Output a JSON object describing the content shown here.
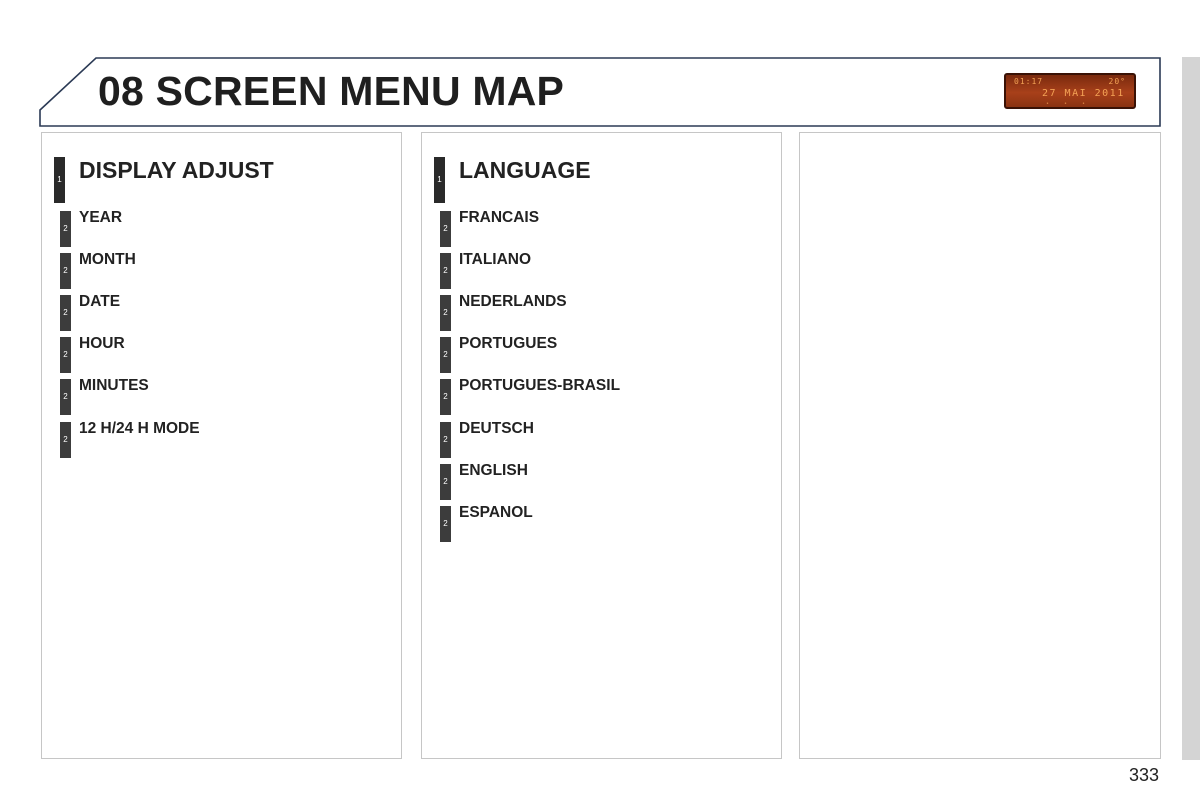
{
  "header": {
    "title": "08 SCREEN MENU MAP",
    "display": {
      "time": "01:17",
      "temp": "20°",
      "date": "27 MAI 2011",
      "dots": "• • •"
    }
  },
  "panels": [
    {
      "heading": {
        "level": "1",
        "label": "DISPLAY ADJUST"
      },
      "items": [
        {
          "level": "2",
          "label": "YEAR"
        },
        {
          "level": "2",
          "label": "MONTH"
        },
        {
          "level": "2",
          "label": "DATE"
        },
        {
          "level": "2",
          "label": "HOUR"
        },
        {
          "level": "2",
          "label": "MINUTES"
        },
        {
          "level": "2",
          "label": "12 H/24 H MODE"
        }
      ]
    },
    {
      "heading": {
        "level": "1",
        "label": "LANGUAGE"
      },
      "items": [
        {
          "level": "2",
          "label": "FRANCAIS"
        },
        {
          "level": "2",
          "label": "ITALIANO"
        },
        {
          "level": "2",
          "label": "NEDERLANDS"
        },
        {
          "level": "2",
          "label": "PORTUGUES"
        },
        {
          "level": "2",
          "label": "PORTUGUES-BRASIL"
        },
        {
          "level": "2",
          "label": "DEUTSCH"
        },
        {
          "level": "2",
          "label": "ENGLISH"
        },
        {
          "level": "2",
          "label": "ESPANOL"
        }
      ]
    }
  ],
  "page_number": "333",
  "colors": {
    "header_border": "#2b3a55",
    "panel_border": "#c6c6c6",
    "marker": "#2a2a2a",
    "lcd_bg": "#a8401a",
    "lcd_text": "#f3a255"
  }
}
